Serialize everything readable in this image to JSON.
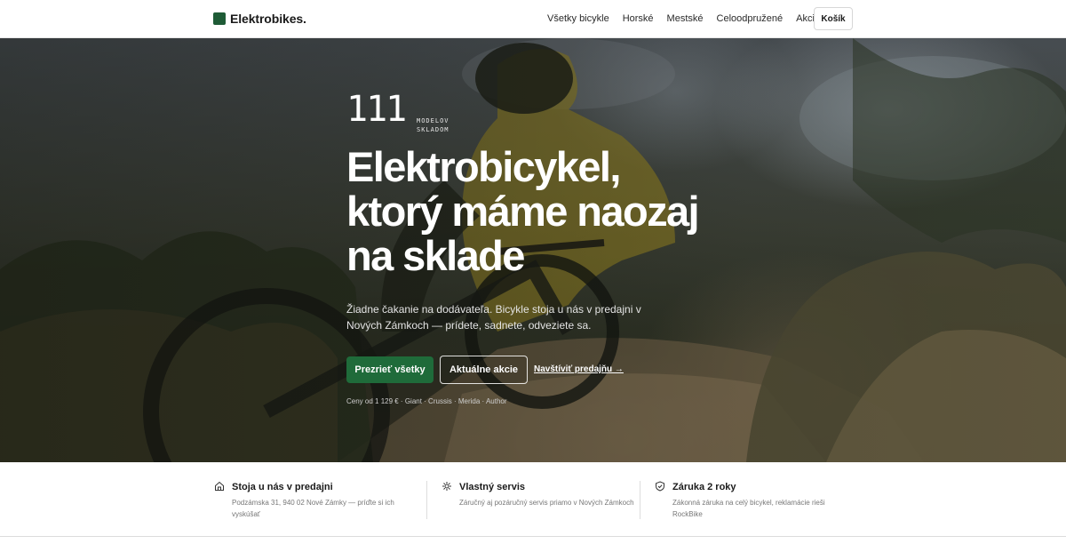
{
  "header": {
    "brand": "Elektrobikes.",
    "nav": [
      "Všetky bicykle",
      "Horské",
      "Mestské",
      "Celoodpružené",
      "Akcie"
    ],
    "cart_label": "Košík"
  },
  "hero": {
    "stock_count": "111",
    "stock_label_line1": "MODELOV",
    "stock_label_line2": "SKLADOM",
    "headline_line1": "Elektrobicykel,",
    "headline_line2": "ktorý máme naozaj",
    "headline_line3": "na sklade",
    "subtext": "Žiadne čakanie na dodávateľa. Bicykle stoja u nás v predajni v Nových Zámkoch — prídete, sadnete, odveziete sa.",
    "primary_button": "Prezrieť všetky",
    "secondary_button": "Aktuálne akcie",
    "visit_link": "Navštíviť predajňu →",
    "prices_note": "Ceny od 1 129 € · Giant · Crussis · Merida · Author",
    "background_image": "mountain-biker-on-trail-photo"
  },
  "features": [
    {
      "icon": "store-icon",
      "title": "Stoja u nás v predajni",
      "desc": "Podzámska 31, 940 02 Nové Zámky — príďte si ich vyskúšať"
    },
    {
      "icon": "service-gear-icon",
      "title": "Vlastný servis",
      "desc": "Záručný aj pozáručný servis priamo v Nových Zámkoch"
    },
    {
      "icon": "shield-icon",
      "title": "Záruka 2 roky",
      "desc": "Zákonná záruka na celý bicykel, reklamácie rieši RockBike"
    }
  ],
  "colors": {
    "brand_green": "#1f6b3a",
    "logo_green": "#1e5b36",
    "text_dark": "#1a1a1a",
    "muted": "#777777"
  }
}
